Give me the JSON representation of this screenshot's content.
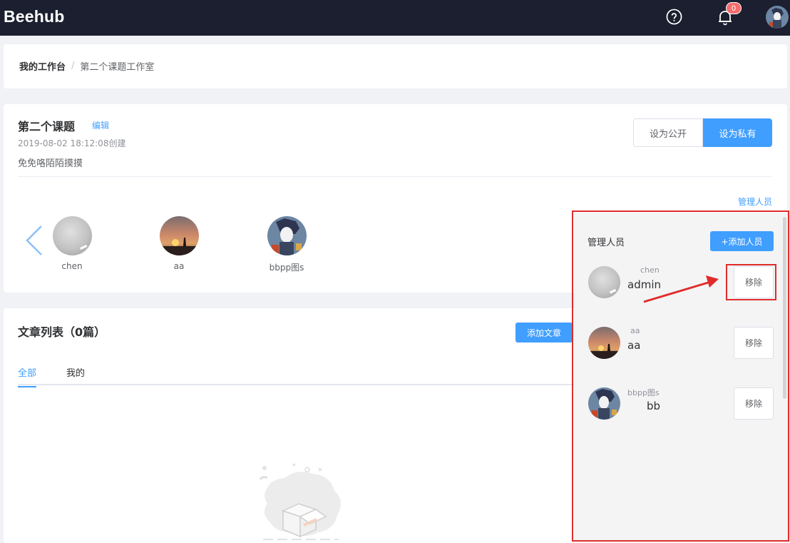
{
  "app": {
    "logo": "Beehub"
  },
  "header": {
    "notification_count": "0"
  },
  "breadcrumb": {
    "home": "我的工作台",
    "separator": "/",
    "current": "第二个课题工作室"
  },
  "project": {
    "title": "第二个课题",
    "edit_label": "编辑",
    "created": "2019-08-02 18:12:08创建",
    "description": "免免咯陌陌摸摸",
    "public_label": "设为公开",
    "private_label": "设为私有",
    "manage_label": "管理人员",
    "members": [
      {
        "name": "chen"
      },
      {
        "name": "aa"
      },
      {
        "name": "bbpp图s"
      }
    ]
  },
  "articles": {
    "title": "文章列表（0篇）",
    "add_label": "添加文章",
    "tabs": [
      {
        "label": "全部"
      },
      {
        "label": "我的"
      }
    ]
  },
  "manager_panel": {
    "title": "管理人员",
    "add_label": "+添加人员",
    "rows": [
      {
        "username": "chen",
        "role": "admin",
        "remove_label": "移除"
      },
      {
        "username": "aa",
        "role": "aa",
        "remove_label": "移除"
      },
      {
        "username": "bbpp图s",
        "role": "bb",
        "remove_label": "移除"
      }
    ]
  },
  "colors": {
    "primary": "#409eff",
    "topbar": "#1c1f2f",
    "annotation": "#e02b2b",
    "badge": "#f56c6c"
  }
}
